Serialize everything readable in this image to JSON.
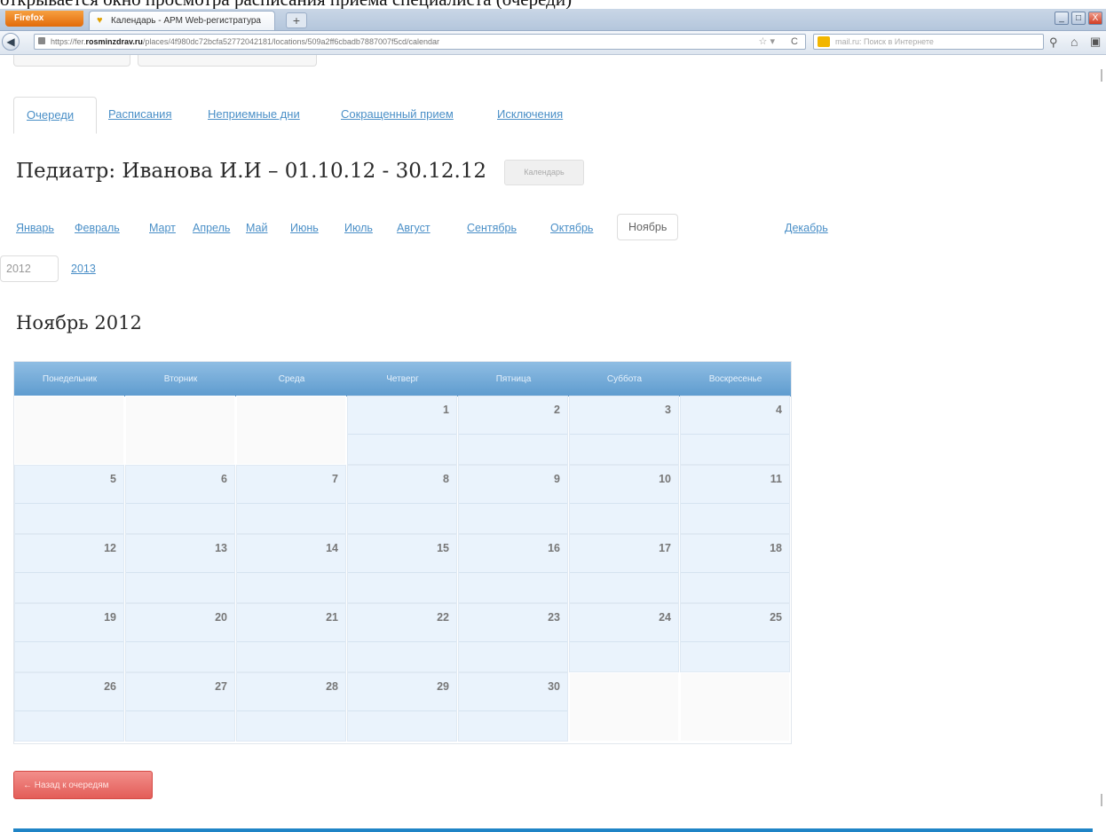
{
  "document_caption": "открывается окно просмотра расписания приема специалиста (очереди)",
  "browser": {
    "firefox_label": "Firefox",
    "tab_title": "Календарь - АРМ Web-регистратура",
    "new_tab_label": "+",
    "url_prefix": "https://fer.",
    "url_domain": "rosminzdrav.ru",
    "url_path": "/places/4f980dc72bcfa52772042181/locations/509a2ff6cbadb7887007f5cd/calendar",
    "search_placeholder": "mail.ru: Поиск в Интернете",
    "minimize_label": "_",
    "maximize_label": "□",
    "close_label": "X"
  },
  "tabs": [
    {
      "label": "Очереди",
      "active": true
    },
    {
      "label": "Расписания",
      "active": false
    },
    {
      "label": "Неприемные дни",
      "active": false
    },
    {
      "label": "Сокращенный прием",
      "active": false
    },
    {
      "label": "Исключения",
      "active": false
    }
  ],
  "page_title": "Педиатр: Иванова И.И – 01.10.12 - 30.12.12",
  "calendar_button": "Календарь",
  "months": [
    {
      "label": "Январь",
      "active": false
    },
    {
      "label": "Февраль",
      "active": false
    },
    {
      "label": "Март",
      "active": false
    },
    {
      "label": "Апрель",
      "active": false
    },
    {
      "label": "Май",
      "active": false
    },
    {
      "label": "Июнь",
      "active": false
    },
    {
      "label": "Июль",
      "active": false
    },
    {
      "label": "Август",
      "active": false
    },
    {
      "label": "Сентябрь",
      "active": false
    },
    {
      "label": "Октябрь",
      "active": false
    },
    {
      "label": "Ноябрь",
      "active": true
    },
    {
      "label": "Декабрь",
      "active": false
    }
  ],
  "years": [
    {
      "label": "2012",
      "active": true
    },
    {
      "label": "2013",
      "active": false
    }
  ],
  "month_title": "Ноябрь 2012",
  "weekdays": [
    "Понедельник",
    "Вторник",
    "Среда",
    "Четверг",
    "Пятница",
    "Суббота",
    "Воскресенье"
  ],
  "weeks": [
    [
      "",
      "",
      "",
      "1",
      "2",
      "3",
      "4"
    ],
    [
      "5",
      "6",
      "7",
      "8",
      "9",
      "10",
      "11"
    ],
    [
      "12",
      "13",
      "14",
      "15",
      "16",
      "17",
      "18"
    ],
    [
      "19",
      "20",
      "21",
      "22",
      "23",
      "24",
      "25"
    ],
    [
      "26",
      "27",
      "28",
      "29",
      "30",
      "",
      ""
    ]
  ],
  "back_button": "← Назад к очередям",
  "colors": {
    "link": "#4a8fc7",
    "header_blue": "#6fa8d8",
    "cell_bg": "#eaf3fc",
    "back_button": "#e86e69",
    "bottom_bar": "#1f84c6"
  }
}
